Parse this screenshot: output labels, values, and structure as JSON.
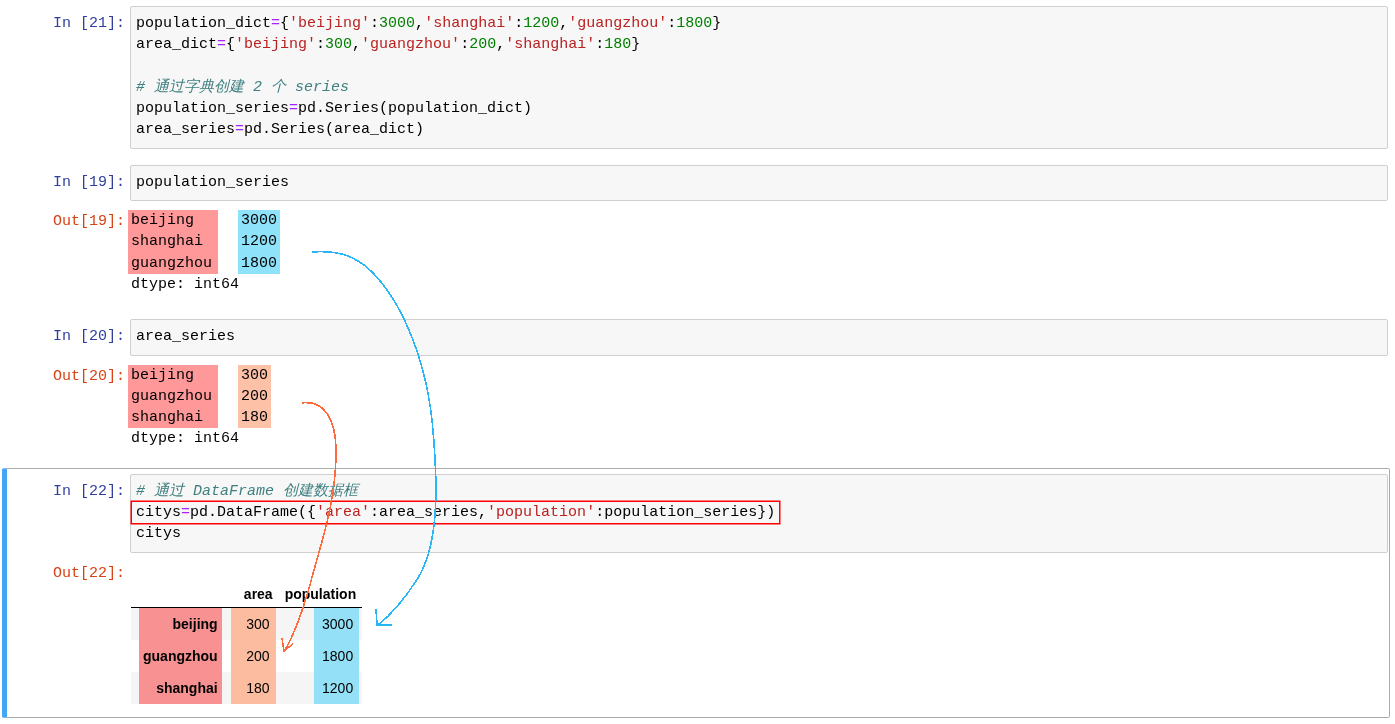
{
  "cells": [
    {
      "selected": false,
      "prompt": "In [21]:",
      "lines": [
        {
          "kind": "code",
          "tokens": [
            {
              "text": "population_dict",
              "kind": "name"
            },
            {
              "text": "=",
              "kind": "op"
            },
            {
              "text": "{",
              "kind": "name"
            },
            {
              "text": "'beijing'",
              "kind": "str"
            },
            {
              "text": ":",
              "kind": "name"
            },
            {
              "text": "3000",
              "kind": "num"
            },
            {
              "text": ",",
              "kind": "name"
            },
            {
              "text": "'shanghai'",
              "kind": "str"
            },
            {
              "text": ":",
              "kind": "name"
            },
            {
              "text": "1200",
              "kind": "num"
            },
            {
              "text": ",",
              "kind": "name"
            },
            {
              "text": "'guangzhou'",
              "kind": "str"
            },
            {
              "text": ":",
              "kind": "name"
            },
            {
              "text": "1800",
              "kind": "num"
            },
            {
              "text": "}",
              "kind": "name"
            }
          ]
        },
        {
          "kind": "code",
          "tokens": [
            {
              "text": "area_dict",
              "kind": "name"
            },
            {
              "text": "=",
              "kind": "op"
            },
            {
              "text": "{",
              "kind": "name"
            },
            {
              "text": "'beijing'",
              "kind": "str"
            },
            {
              "text": ":",
              "kind": "name"
            },
            {
              "text": "300",
              "kind": "num"
            },
            {
              "text": ",",
              "kind": "name"
            },
            {
              "text": "'guangzhou'",
              "kind": "str"
            },
            {
              "text": ":",
              "kind": "name"
            },
            {
              "text": "200",
              "kind": "num"
            },
            {
              "text": ",",
              "kind": "name"
            },
            {
              "text": "'shanghai'",
              "kind": "str"
            },
            {
              "text": ":",
              "kind": "name"
            },
            {
              "text": "180",
              "kind": "num"
            },
            {
              "text": "}",
              "kind": "name"
            }
          ]
        },
        {
          "kind": "blank"
        },
        {
          "kind": "code",
          "tokens": [
            {
              "text": "# 通过字典创建 2 个 series",
              "kind": "comment"
            }
          ]
        },
        {
          "kind": "code",
          "tokens": [
            {
              "text": "population_series",
              "kind": "name"
            },
            {
              "text": "=",
              "kind": "op"
            },
            {
              "text": "pd.Series(population_dict)",
              "kind": "name"
            }
          ]
        },
        {
          "kind": "code",
          "tokens": [
            {
              "text": "area_series",
              "kind": "name"
            },
            {
              "text": "=",
              "kind": "op"
            },
            {
              "text": "pd.Series(area_dict)",
              "kind": "name"
            }
          ]
        }
      ]
    },
    {
      "selected": false,
      "prompt": "In [19]:",
      "lines": [
        {
          "kind": "code",
          "tokens": [
            {
              "text": "population_series",
              "kind": "name"
            }
          ]
        }
      ],
      "output": {
        "kind": "series",
        "prompt": "Out[19]:",
        "index_column": {
          "color": "#ff9999"
        },
        "color": "#8ee3fb",
        "rows": [
          {
            "index": "beijing",
            "value": "3000"
          },
          {
            "index": "shanghai",
            "value": "1200"
          },
          {
            "index": "guangzhou",
            "value": "1800"
          }
        ],
        "dtype": "dtype: int64"
      }
    },
    {
      "selected": false,
      "prompt": "In [20]:",
      "lines": [
        {
          "kind": "code",
          "tokens": [
            {
              "text": "area_series",
              "kind": "name"
            }
          ]
        }
      ],
      "output": {
        "kind": "series",
        "prompt": "Out[20]:",
        "index_column": {
          "color": "#ff9999"
        },
        "color": "#fdc1a8",
        "rows": [
          {
            "index": "beijing",
            "value": "300"
          },
          {
            "index": "guangzhou",
            "value": "200"
          },
          {
            "index": "shanghai",
            "value": "180"
          }
        ],
        "dtype": "dtype: int64"
      }
    },
    {
      "selected": true,
      "prompt": "In [22]:",
      "lines": [
        {
          "kind": "code",
          "boxed": false,
          "tokens": [
            {
              "text": "# 通过 DataFrame 创建数据框",
              "kind": "comment"
            }
          ]
        },
        {
          "kind": "code",
          "boxed": true,
          "tokens": [
            {
              "text": "citys",
              "kind": "name"
            },
            {
              "text": "=",
              "kind": "op"
            },
            {
              "text": "pd.DataFrame({",
              "kind": "name"
            },
            {
              "text": "'area'",
              "kind": "str"
            },
            {
              "text": ":area_series,",
              "kind": "name"
            },
            {
              "text": "'population'",
              "kind": "str"
            },
            {
              "text": ":population_series})",
              "kind": "name"
            }
          ]
        },
        {
          "kind": "code",
          "boxed": false,
          "tokens": [
            {
              "text": "citys",
              "kind": "name"
            }
          ]
        }
      ],
      "output": {
        "kind": "dataframe",
        "prompt": "Out[22]:",
        "index_column": {
          "color": "#f89191"
        },
        "columns": [
          {
            "label": "area",
            "color": "#fbbca0"
          },
          {
            "label": "population",
            "color": "#94e0f7"
          }
        ],
        "rows": [
          {
            "index": "beijing",
            "cells": [
              "300",
              "3000"
            ]
          },
          {
            "index": "guangzhou",
            "cells": [
              "200",
              "1800"
            ]
          },
          {
            "index": "shanghai",
            "cells": [
              "180",
              "1200"
            ]
          }
        ]
      }
    }
  ],
  "annotations": [
    {
      "kind": "arrow",
      "color": "#29b6f6"
    },
    {
      "kind": "arrow",
      "color": "#ff6a3d"
    }
  ]
}
